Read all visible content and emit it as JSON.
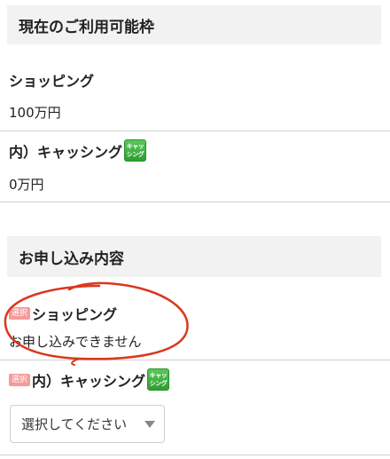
{
  "limits": {
    "header": "現在のご利用可能枠",
    "shopping_label": "ショッピング",
    "shopping_value": "100万円",
    "cashing_label": "内）キャッシング",
    "cashing_value": "0万円",
    "cashing_icon_top": "キャッ",
    "cashing_icon_bottom": "シング"
  },
  "application": {
    "header": "お申し込み内容",
    "select_badge": "選択",
    "shopping_label": "ショッピング",
    "shopping_status": "お申し込みできません",
    "cashing_label": "内）キャッシング",
    "cashing_icon_top": "キャッ",
    "cashing_icon_bottom": "シング",
    "select_placeholder": "選択してください"
  },
  "colors": {
    "header_bg": "#f2f2f2",
    "badge": "#f59a9a",
    "cash_icon": "#3fae3f",
    "annotation_circle": "#d9381e"
  }
}
